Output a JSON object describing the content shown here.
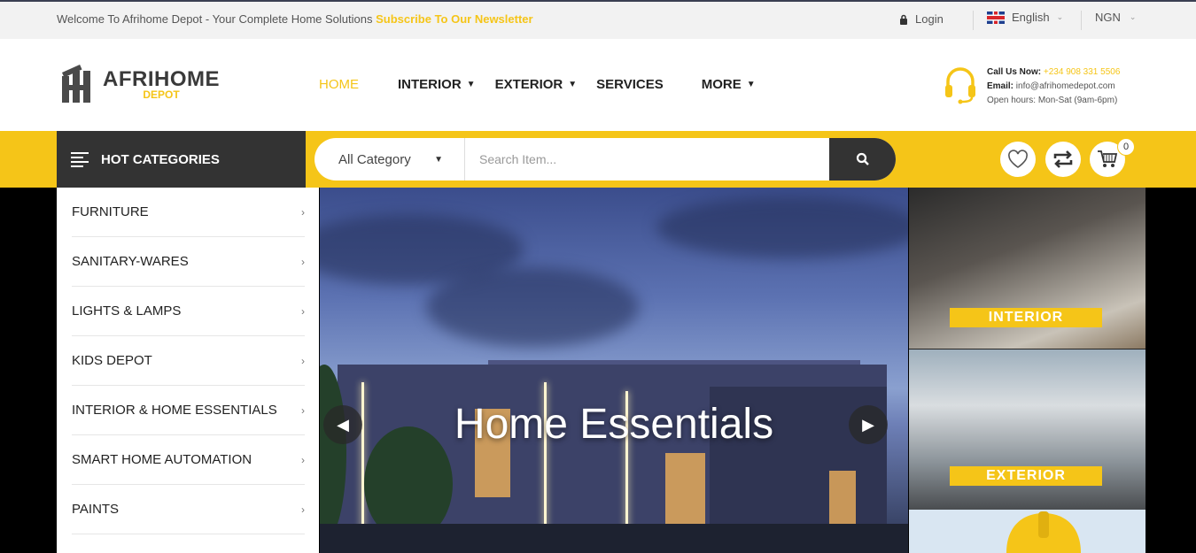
{
  "topbar": {
    "welcome": "Welcome To Afrihome Depot - Your Complete Home Solutions",
    "newsletter": "Subscribe To Our Newsletter",
    "login": "Login",
    "language": "English",
    "currency": "NGN"
  },
  "header": {
    "logo_main": "AFRIHOME",
    "logo_sub": "DEPOT",
    "nav": [
      {
        "label": "HOME"
      },
      {
        "label": "INTERIOR"
      },
      {
        "label": "EXTERIOR"
      },
      {
        "label": "SERVICES"
      },
      {
        "label": "MORE"
      }
    ],
    "contact": {
      "call_label": "Call Us Now:",
      "phone": "+234 908 331 5506",
      "email_label": "Email:",
      "email": "info@afrihomedepot.com",
      "hours": "Open hours: Mon-Sat (9am-6pm)"
    }
  },
  "categories_bar": {
    "title": "HOT CATEGORIES"
  },
  "search": {
    "category": "All Category",
    "placeholder": "Search Item..."
  },
  "cart": {
    "count": "0"
  },
  "sidebar": {
    "items": [
      {
        "label": "FURNITURE"
      },
      {
        "label": "SANITARY-WARES"
      },
      {
        "label": "LIGHTS & LAMPS"
      },
      {
        "label": "KIDS DEPOT"
      },
      {
        "label": "INTERIOR & HOME ESSENTIALS"
      },
      {
        "label": "SMART HOME AUTOMATION"
      },
      {
        "label": "PAINTS"
      }
    ]
  },
  "hero": {
    "title": "Home Essentials"
  },
  "banners": [
    {
      "label": "INTERIOR"
    },
    {
      "label": "EXTERIOR"
    }
  ],
  "colors": {
    "accent": "#f5c518",
    "dark": "#333333"
  }
}
